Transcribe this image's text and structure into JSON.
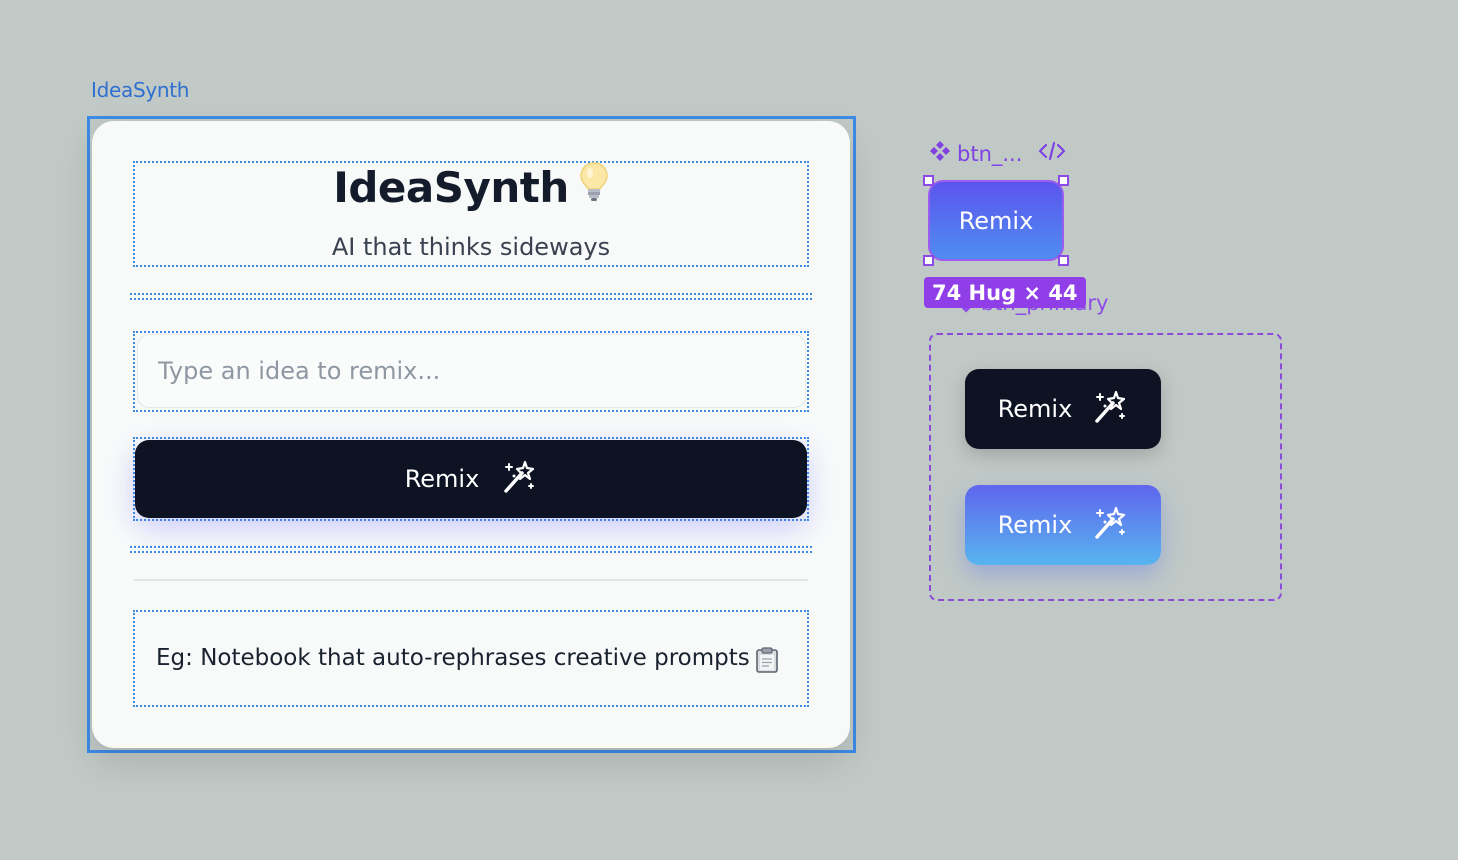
{
  "frame": {
    "label": "IdeaSynth"
  },
  "app": {
    "title": "IdeaSynth",
    "subtitle": "AI that thinks sideways",
    "input_placeholder": "Type an idea to remix...",
    "button_label": "Remix",
    "example_text": "Eg: Notebook that auto-rephrases creative prompts"
  },
  "component": {
    "tag_name": "btn_...",
    "selected_button_label": "Remix",
    "size_badge": "74 Hug × 44",
    "variant_set_name": "btn_primary",
    "variants": [
      {
        "label": "Remix",
        "style": "dark"
      },
      {
        "label": "Remix",
        "style": "gradient"
      }
    ]
  },
  "colors": {
    "canvas": "#c1c9c6",
    "selection_blue": "#3d8be6",
    "component_purple": "#8f3ee8",
    "button_dark": "#0d1323"
  },
  "icons": [
    "lightbulb-icon",
    "magic-wand-icon",
    "clipboard-icon",
    "component-icon",
    "code-icon"
  ]
}
